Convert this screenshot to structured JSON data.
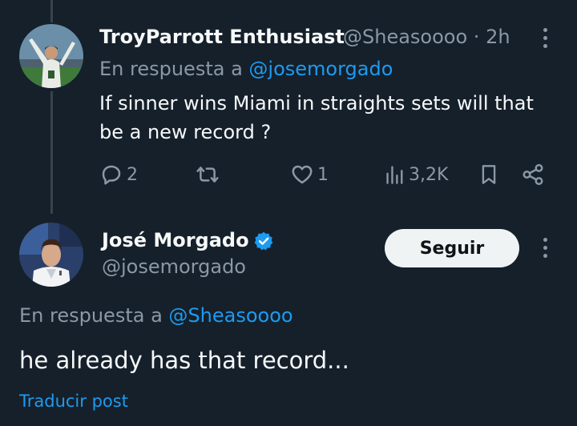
{
  "reply_tweet": {
    "display_name": "TroyParrott Enthusiast",
    "handle": "@Sheasoooo",
    "separator": "·",
    "time": "2h",
    "reply_prefix": "En respuesta a",
    "reply_to": "@josemorgado",
    "text_line1": "If sinner wins Miami in straights sets will that",
    "text_line2": "be a new record ?",
    "actions": {
      "replies": "2",
      "retweets": "",
      "likes": "1",
      "views": "3,2K"
    }
  },
  "main_tweet": {
    "display_name": "José Morgado",
    "verified": true,
    "handle": "@josemorgado",
    "follow_label": "Seguir",
    "reply_prefix": "En respuesta a",
    "reply_to": "@Sheasoooo",
    "text": "he already has that record...",
    "translate_label": "Traducir post"
  },
  "colors": {
    "background": "#15202b",
    "accent": "#1d9bf0",
    "muted": "#8b98a5",
    "text": "#f7f9f9"
  },
  "icons": [
    "reply-icon",
    "retweet-icon",
    "like-icon",
    "views-icon",
    "bookmark-icon",
    "share-icon",
    "more-icon",
    "verified-badge-icon"
  ]
}
